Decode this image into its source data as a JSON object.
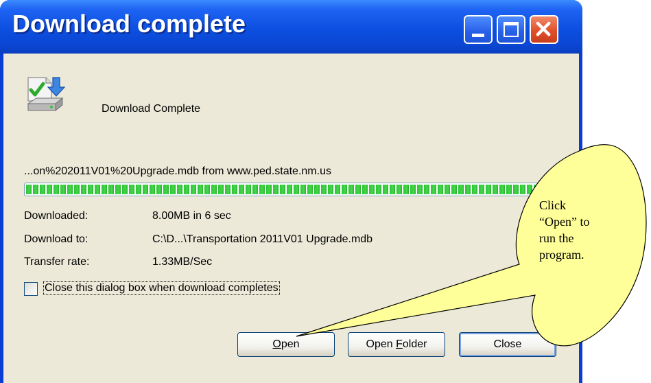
{
  "window": {
    "title": "Download complete"
  },
  "dialog": {
    "headline": "Download Complete",
    "url": "...on%202011V01%20Upgrade.mdb from www.ped.state.nm.us",
    "progress": 1.0,
    "info": [
      {
        "label": "Downloaded:",
        "value": "8.00MB in 6 sec"
      },
      {
        "label": "Download to:",
        "value": "C:\\D...\\Transportation 2011V01 Upgrade.mdb"
      },
      {
        "label": "Transfer rate:",
        "value": "1.33MB/Sec"
      }
    ],
    "checkbox_label": "Close this dialog box when download completes",
    "checkbox_checked": false,
    "buttons": {
      "open_prefix": "",
      "open_mnemonic": "O",
      "open_rest": "pen",
      "folder_prefix": "Open ",
      "folder_mnemonic": "F",
      "folder_rest": "older",
      "close": "Close"
    }
  },
  "callout": {
    "lines": [
      "Click",
      "“Open” to",
      "run the",
      "program."
    ],
    "fill": "#ffff99"
  },
  "icons": {
    "dialog_icon": "download-complete-icon",
    "minimize": "minimize-icon",
    "maximize": "maximize-icon",
    "close": "close-icon"
  },
  "colors": {
    "titlebar": "#0a46d2",
    "client": "#ece9d8",
    "progress": "#2ec435",
    "close_button": "#e0502a"
  }
}
